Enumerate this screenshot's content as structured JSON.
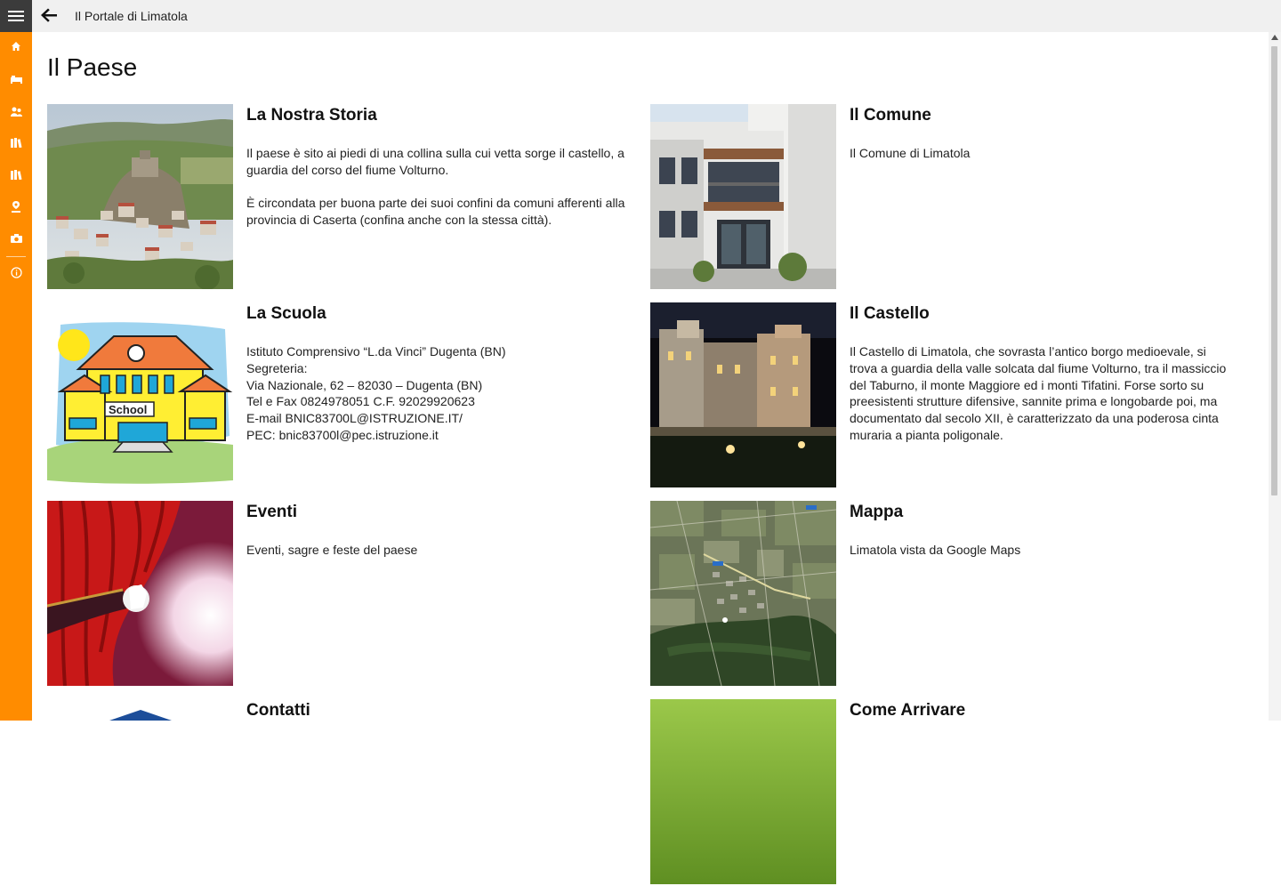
{
  "app": {
    "title": "Il Portale di Limatola"
  },
  "page": {
    "title": "Il Paese"
  },
  "nav": {
    "icons": [
      "home-icon",
      "bed-icon",
      "people-icon",
      "books-icon",
      "library-icon",
      "location-pin-icon",
      "camera-icon",
      "info-icon"
    ]
  },
  "tiles": [
    {
      "title": "La Nostra Storia",
      "desc": "Il paese è sito ai piedi di una collina sulla cui vetta sorge il castello, a guardia del corso del fiume Volturno.\n\nÈ circondata per buona parte dei suoi confini da comuni afferenti alla provincia di Caserta (confina anche con la stessa città)."
    },
    {
      "title": "Il Comune",
      "desc": "Il Comune di Limatola"
    },
    {
      "title": "La Scuola",
      "desc": "Istituto Comprensivo “L.da Vinci” Dugenta (BN)\nSegreteria:\nVia Nazionale, 62 – 82030 – Dugenta (BN)\nTel e Fax 0824978051 C.F. 92029920623\nE-mail BNIC83700L@ISTRUZIONE.IT/\nPEC: bnic83700l@pec.istruzione.it"
    },
    {
      "title": "Il Castello",
      "desc": "Il Castello di Limatola, che sovrasta l’antico borgo medioevale, si trova a guardia della valle solcata dal fiume Volturno, tra il massiccio del Taburno, il monte Maggiore ed i monti Tifatini. Forse sorto su preesistenti strutture difensive, sannite prima e longobarde poi, ma documentato dal secolo XII, è caratterizzato da una poderosa cinta muraria a pianta poligonale."
    },
    {
      "title": "Eventi",
      "desc": "Eventi, sagre e feste del paese"
    },
    {
      "title": "Mappa",
      "desc": "Limatola vista da Google Maps"
    },
    {
      "title": "Contatti",
      "desc": ""
    },
    {
      "title": "Come Arrivare",
      "desc": ""
    }
  ],
  "images": {
    "school_sign": "School"
  },
  "colors": {
    "accent": "#ff8c00",
    "hamburger_bg": "#3b3b3b",
    "titlebar_bg": "#f0f0f0"
  }
}
